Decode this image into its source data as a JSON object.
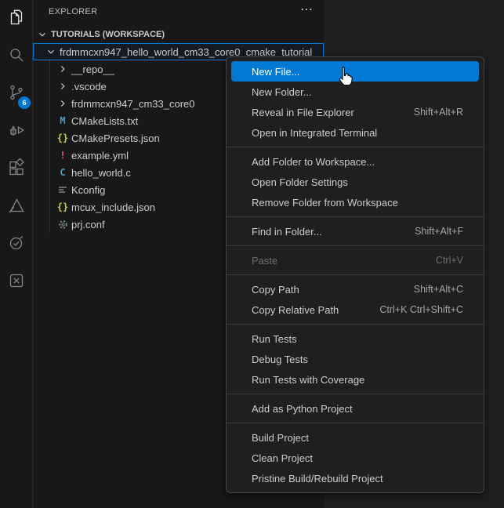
{
  "activity_bar": {
    "items": [
      {
        "name": "explorer",
        "active": true
      },
      {
        "name": "search",
        "active": false
      },
      {
        "name": "source-control",
        "active": false,
        "badge": "6"
      },
      {
        "name": "run-and-debug",
        "active": false
      },
      {
        "name": "extensions",
        "active": false
      },
      {
        "name": "mcuxpresso",
        "active": false
      },
      {
        "name": "testing",
        "active": false
      },
      {
        "name": "x-extension",
        "active": false
      }
    ],
    "badge_color": "#0078d4"
  },
  "explorer": {
    "title": "EXPLORER",
    "more_actions_icon": "⋯",
    "workspace_label": "TUTORIALS (WORKSPACE)",
    "tree": [
      {
        "label": "frdmmcxn947_hello_world_cm33_core0_cmake_tutorial",
        "type": "folder-expanded",
        "selected": true
      },
      {
        "label": "__repo__",
        "type": "folder-collapsed"
      },
      {
        "label": ".vscode",
        "type": "folder-collapsed"
      },
      {
        "label": "frdmmcxn947_cm33_core0",
        "type": "folder-collapsed"
      },
      {
        "label": "CMakeLists.txt",
        "icon": "cmake-file-icon",
        "icon_glyph": "M",
        "icon_color": "#519aba"
      },
      {
        "label": "CMakePresets.json",
        "icon": "json-file-icon",
        "icon_glyph": "{}",
        "icon_color": "#cbcb41"
      },
      {
        "label": "example.yml",
        "icon": "yaml-file-icon",
        "icon_glyph": "!",
        "icon_color": "#e1568e"
      },
      {
        "label": "hello_world.c",
        "icon": "c-file-icon",
        "icon_glyph": "C",
        "icon_color": "#519aba"
      },
      {
        "label": "Kconfig",
        "icon": "kconfig-file-icon",
        "icon_glyph": "",
        "icon_color": "#848484"
      },
      {
        "label": "mcux_include.json",
        "icon": "json-file-icon",
        "icon_glyph": "{}",
        "icon_color": "#cbcb41"
      },
      {
        "label": "prj.conf",
        "icon": "gear-file-icon",
        "icon_glyph": "",
        "icon_color": "#6d8086"
      }
    ],
    "selection": {
      "border_color": "#0078d4",
      "background": "#141a21"
    }
  },
  "context_menu": {
    "highlight_color": "#0078d4",
    "groups": [
      {
        "items": [
          {
            "label": "New File...",
            "highlighted": true
          },
          {
            "label": "New Folder..."
          },
          {
            "label": "Reveal in File Explorer",
            "shortcut": "Shift+Alt+R"
          },
          {
            "label": "Open in Integrated Terminal"
          }
        ]
      },
      {
        "items": [
          {
            "label": "Add Folder to Workspace..."
          },
          {
            "label": "Open Folder Settings"
          },
          {
            "label": "Remove Folder from Workspace"
          }
        ]
      },
      {
        "items": [
          {
            "label": "Find in Folder...",
            "shortcut": "Shift+Alt+F"
          }
        ]
      },
      {
        "items": [
          {
            "label": "Paste",
            "shortcut": "Ctrl+V",
            "disabled": true
          }
        ]
      },
      {
        "items": [
          {
            "label": "Copy Path",
            "shortcut": "Shift+Alt+C"
          },
          {
            "label": "Copy Relative Path",
            "shortcut": "Ctrl+K Ctrl+Shift+C"
          }
        ]
      },
      {
        "items": [
          {
            "label": "Run Tests"
          },
          {
            "label": "Debug Tests"
          },
          {
            "label": "Run Tests with Coverage"
          }
        ]
      },
      {
        "items": [
          {
            "label": "Add as Python Project"
          }
        ]
      },
      {
        "items": [
          {
            "label": "Build Project"
          },
          {
            "label": "Clean Project"
          },
          {
            "label": "Pristine Build/Rebuild Project"
          }
        ]
      }
    ]
  },
  "cursor_icon": "hand-pointer"
}
